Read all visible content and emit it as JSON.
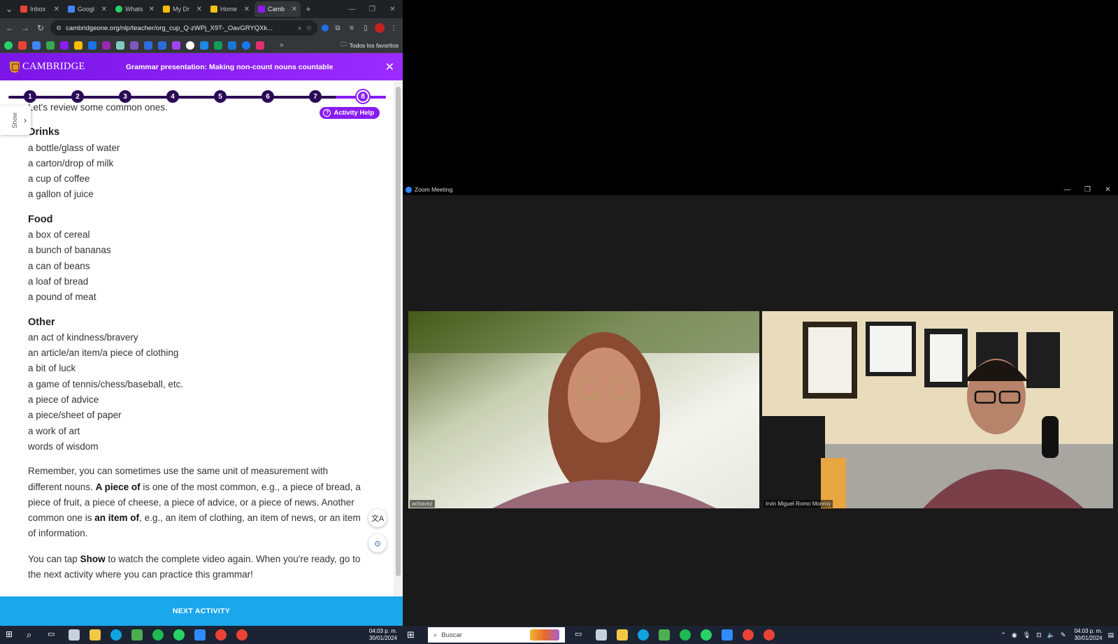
{
  "browser": {
    "tabs": [
      {
        "label": "Inbox",
        "color": "#ea4335"
      },
      {
        "label": "Googl",
        "color": "#4285f4"
      },
      {
        "label": "Whats",
        "color": "#25d366"
      },
      {
        "label": "My Dr",
        "color": "#fbbc04"
      },
      {
        "label": "Home",
        "color": "#f4c20d"
      },
      {
        "label": "Camb",
        "color": "#8a1cf5",
        "active": true
      }
    ],
    "url": "cambridgeone.org/nlp/teacher/org_cup_Q-zWPj_X9T-_OavGRYQXk...",
    "bookmarks_folder": "Todos los favoritos"
  },
  "cambridge": {
    "logo": "CAMBRIDGE",
    "title": "Grammar presentation: Making non-count nouns countable",
    "steps": [
      "1",
      "2",
      "3",
      "4",
      "5",
      "6",
      "7",
      "8"
    ],
    "current_step": 8,
    "activity_help": "Activity Help",
    "show_label": "Show",
    "intro_line": "Let's review some common ones.",
    "sections": [
      {
        "heading": "Drinks",
        "items": [
          "a bottle/glass of water",
          "a carton/drop of milk",
          "a cup of coffee",
          "a gallon of juice"
        ]
      },
      {
        "heading": "Food",
        "items": [
          "a box of cereal",
          "a bunch of bananas",
          "a can of beans",
          "a loaf of bread",
          "a pound of meat"
        ]
      },
      {
        "heading": "Other",
        "items": [
          "an act of kindness/bravery",
          "an article/an item/a piece of clothing",
          "a bit of luck",
          "a game of tennis/chess/baseball, etc.",
          "a piece of advice",
          "a piece/sheet of paper",
          "a work of art",
          "words of wisdom"
        ]
      }
    ],
    "para1": {
      "a": "Remember, you can sometimes use the same unit of measurement with different nouns. ",
      "b1": "A piece of",
      "c": " is one of the most common, e.g., a piece of bread, a piece of fruit, a piece of cheese, a piece of advice, or a piece of news. Another common one is ",
      "b2": "an item of",
      "d": ", e.g., an item of clothing, an item of news, or an item of information."
    },
    "para2": {
      "a": "You can tap ",
      "b": "Show",
      "c": " to watch the complete video again. When you're ready, go to the next activity where you can practice this grammar!"
    },
    "next_activity": "NEXT ACTIVITY"
  },
  "taskbar_left": {
    "time": "04:03 p. m.",
    "date": "30/01/2024"
  },
  "zoom": {
    "window_title": "Zoom Meeting",
    "participants": [
      {
        "name": "achavez"
      },
      {
        "name": "Irvin Miguel Romo Monroy"
      }
    ]
  },
  "taskbar_right": {
    "search_placeholder": "Buscar",
    "time": "04:03 p. m.",
    "date": "30/01/2024"
  }
}
